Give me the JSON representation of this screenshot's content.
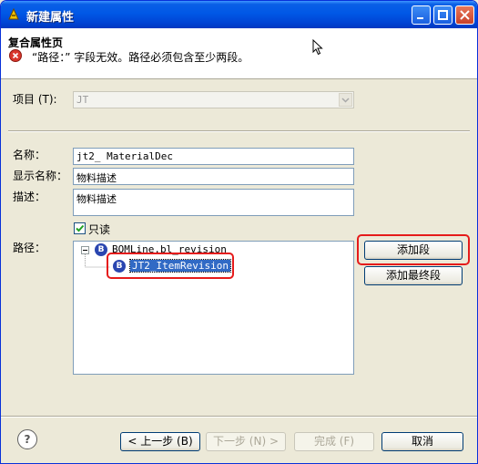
{
  "window": {
    "title": "新建属性"
  },
  "header": {
    "title": "复合属性页",
    "error": "“路径：” 字段无效。路径必须包含至少两段。"
  },
  "form": {
    "project_label": "项目 (T):",
    "project_value": "JT",
    "name_label": "名称：",
    "name_value": "jt2_ MaterialDec",
    "display_label": "显示名称：",
    "display_value": "物料描述",
    "desc_label": "描述：",
    "desc_value": "物料描述",
    "readonly_label": "只读",
    "readonly_checked": true,
    "path_label": "路径："
  },
  "tree": {
    "root_label": "BOMLine.bl_revision",
    "child_label": "JT2_ItemRevision"
  },
  "buttons": {
    "add_segment": "添加段",
    "add_final_segment": "添加最终段",
    "back": "< 上一步 (B)",
    "next": "下一步 (N) >",
    "finish": "完成 (F)",
    "cancel": "取消"
  }
}
